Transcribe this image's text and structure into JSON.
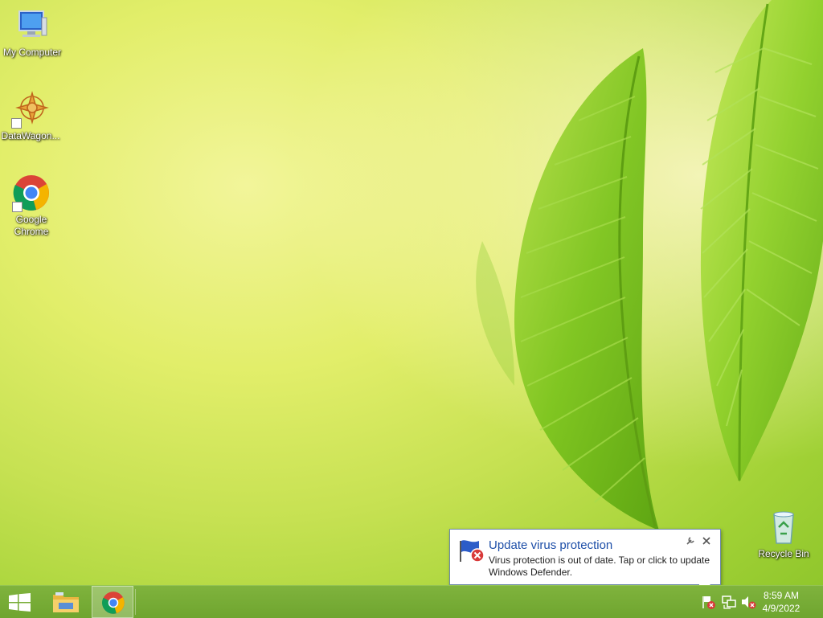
{
  "desktop": {
    "icons": [
      {
        "label": "My Computer"
      },
      {
        "label": "DataWagon..."
      },
      {
        "label": "Google Chrome"
      },
      {
        "label": "Recycle Bin"
      }
    ]
  },
  "notification": {
    "title": "Update virus protection",
    "body": "Virus protection is out of date. Tap or click to update Windows Defender."
  },
  "taskbar": {
    "clock": {
      "time": "8:59 AM",
      "date": "4/9/2022"
    }
  },
  "icons": {
    "start": "windows-logo-icon",
    "explorer": "file-explorer-icon",
    "chrome": "chrome-icon",
    "action_center": "flag-warning-icon",
    "network": "network-icon",
    "volume": "volume-muted-icon"
  },
  "colors": {
    "taskbar": "#74aa33",
    "notify_title": "#1e4fa8"
  }
}
